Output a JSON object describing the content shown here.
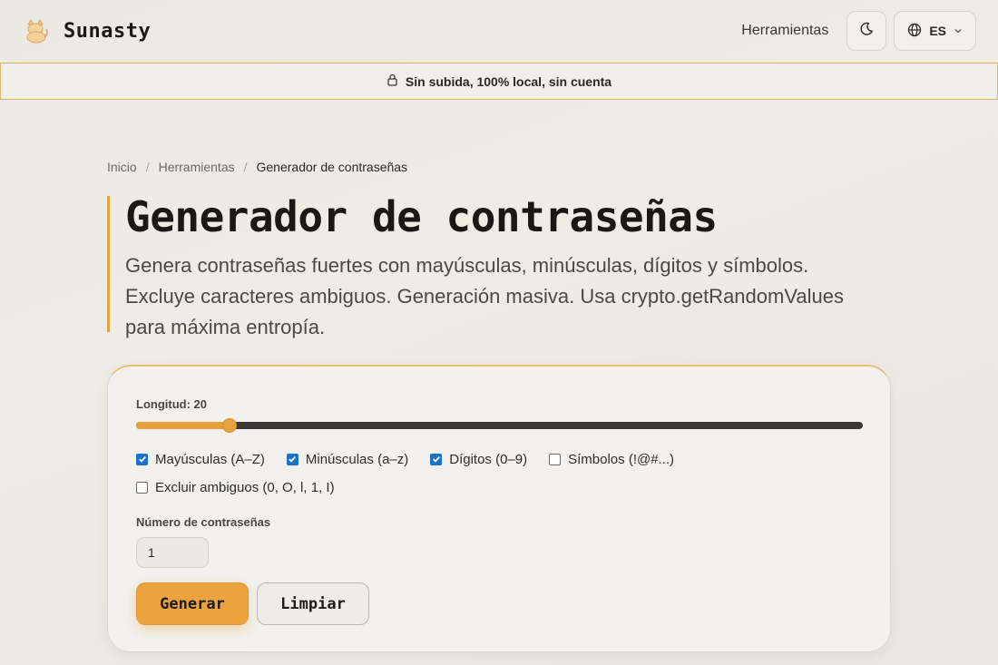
{
  "header": {
    "brand": "Sunasty",
    "nav_link": "Herramientas",
    "language": "ES"
  },
  "banner": {
    "text": "Sin subida, 100% local, sin cuenta"
  },
  "breadcrumb": {
    "items": [
      "Inicio",
      "Herramientas",
      "Generador de contraseñas"
    ]
  },
  "page": {
    "title": "Generador de contraseñas",
    "description": "Genera contraseñas fuertes con mayúsculas, minúsculas, dígitos y símbolos. Excluye caracteres ambiguos. Generación masiva. Usa crypto.getRandomValues para máxima entropía."
  },
  "form": {
    "length_label": "Longitud: 20",
    "length_value": 20,
    "length_min": 4,
    "length_max": 128,
    "options": [
      {
        "label": "Mayúsculas (A–Z)",
        "checked": true
      },
      {
        "label": "Minúsculas (a–z)",
        "checked": true
      },
      {
        "label": "Dígitos (0–9)",
        "checked": true
      },
      {
        "label": "Símbolos (!@#...)",
        "checked": false
      }
    ],
    "exclude_ambiguous": {
      "label": "Excluir ambiguos (0, O, l, 1, I)",
      "checked": false
    },
    "count_label": "Número de contraseñas",
    "count_value": "1",
    "generate_label": "Generar",
    "clear_label": "Limpiar"
  },
  "colors": {
    "accent": "#e5a23e",
    "checkbox": "#1a73c9",
    "banner_border": "#e2b66a"
  },
  "icons": {
    "logo": "cat-logo-icon",
    "theme": "moon-icon",
    "language": "globe-icon",
    "dropdown": "chevron-down-icon",
    "banner": "lock-icon"
  }
}
